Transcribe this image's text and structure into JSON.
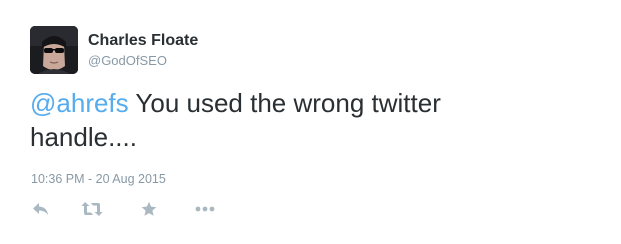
{
  "author": {
    "name": "Charles Floate",
    "handle": "@GodOfSEO"
  },
  "tweet": {
    "mention": "@ahrefs",
    "text_line1": " You used the wrong twitter",
    "text_line2": "handle....",
    "timestamp": "10:36 PM - 20 Aug 2015"
  },
  "actions": {
    "reply_icon": "reply-icon",
    "retweet_icon": "retweet-icon",
    "favorite_icon": "star-icon",
    "more_icon": "more-icon"
  },
  "colors": {
    "text": "#292f33",
    "muted": "#8899a6",
    "mention": "#55acee",
    "icon": "#aab8c2"
  }
}
